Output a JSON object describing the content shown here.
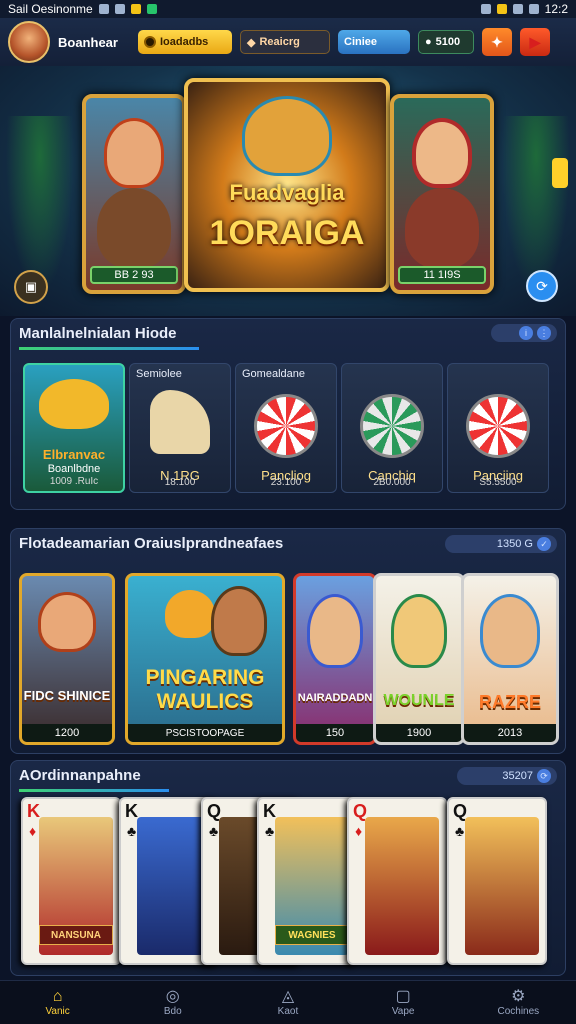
{
  "status": {
    "left_label": "Sail Oesinonme",
    "time": "12:2"
  },
  "header": {
    "username": "Boanhear",
    "gold_button": "Ioadadbs",
    "dark_button": "Reaicrg",
    "blue_button": "Ciniee",
    "green_button": "5100"
  },
  "hero": {
    "title_top": "Fuadvaglia",
    "title_bottom": "1ORAIGA",
    "left_plate": "BB 2 93",
    "right_plate": "11 1I9S"
  },
  "section1": {
    "title": "Manlalnelnialan Hiode",
    "tiles": [
      {
        "top": "",
        "caption": "Boanlbdne",
        "sub": "1009 .RuIc",
        "overlay": "Elbranvac"
      },
      {
        "top": "Semiolee",
        "caption": "N.1RG",
        "sub": "18.100"
      },
      {
        "top": "Gomealdane",
        "caption": "Pancliog",
        "sub": "23.100"
      },
      {
        "top": "",
        "caption": "Canchiq",
        "sub": "2B0.000"
      },
      {
        "top": "",
        "caption": "Panciing",
        "sub": "S5.5500"
      }
    ]
  },
  "section2": {
    "title": "Flotadeamarian Oraiuslprandneafaes",
    "pill": "1350 G",
    "tiles": [
      {
        "label": "FIDC SHINICE",
        "bar": "1200"
      },
      {
        "label": "PINGARING WAULICS",
        "bar": "PSCISTOOPAGE"
      },
      {
        "label": "NAIRADDADN",
        "bar": "150"
      },
      {
        "label": "WOUNLE",
        "bar": "1900"
      },
      {
        "label": "RAZRE",
        "bar": "2013"
      }
    ]
  },
  "section3": {
    "title": "AOrdinnanpahne",
    "pill": "35207",
    "cards": [
      {
        "rank": "K",
        "suit": "♦",
        "banner": "NANSUNA"
      },
      {
        "rank": "K",
        "suit": "♣",
        "banner": ""
      },
      {
        "rank": "Q",
        "suit": "♣",
        "banner": ""
      },
      {
        "rank": "K",
        "suit": "♣",
        "banner": "WAGNIES"
      },
      {
        "rank": "Q",
        "suit": "♦",
        "banner": ""
      },
      {
        "rank": "Q",
        "suit": "♣",
        "banner": ""
      }
    ]
  },
  "nav": [
    {
      "label": "Vanic",
      "icon": "home-icon"
    },
    {
      "label": "Bdo",
      "icon": "chat-icon"
    },
    {
      "label": "Kaot",
      "icon": "compass-icon"
    },
    {
      "label": "Vape",
      "icon": "square-icon"
    },
    {
      "label": "Cochines",
      "icon": "gear-icon"
    }
  ],
  "colors": {
    "accent": "#ffd23a",
    "panel": "#1a2846",
    "gold": "#e2a82a"
  }
}
